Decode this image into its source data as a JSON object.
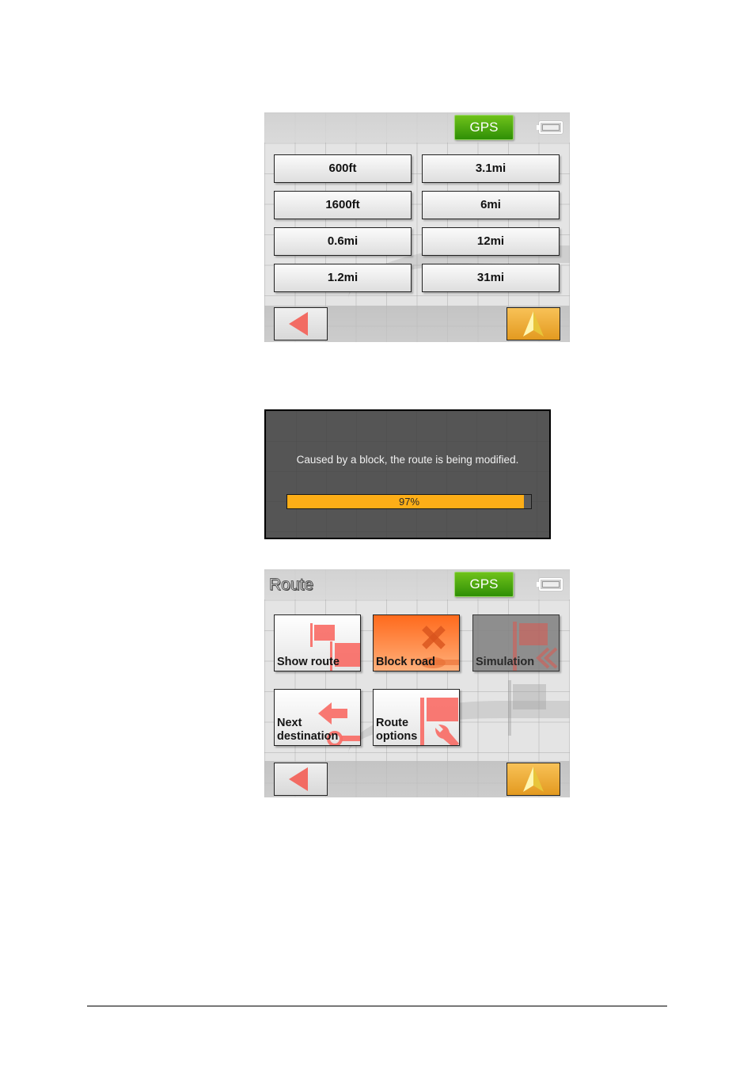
{
  "screen1": {
    "status": {
      "gps_label": "GPS",
      "battery_icon": "battery-icon"
    },
    "distance_options": [
      {
        "label": "600ft"
      },
      {
        "label": "3.1mi"
      },
      {
        "label": "1600ft"
      },
      {
        "label": "6mi"
      },
      {
        "label": "0.6mi"
      },
      {
        "label": "12mi"
      },
      {
        "label": "1.2mi"
      },
      {
        "label": "31mi"
      }
    ],
    "back_icon": "back-arrow-icon",
    "nav_icon": "navigation-arrow-icon"
  },
  "dialog": {
    "message": "Caused by a block, the route is being modified.",
    "progress_percent": 97,
    "progress_label": "97%",
    "progress_color": "#fdae17"
  },
  "screen2": {
    "title": "Route",
    "status": {
      "gps_label": "GPS",
      "battery_icon": "battery-icon"
    },
    "tiles": [
      {
        "label": "Show route",
        "icon": "flags-icon",
        "state": "normal"
      },
      {
        "label": "Block road",
        "icon": "block-x-icon",
        "state": "highlighted",
        "color": "#ff6a1c"
      },
      {
        "label": "Simulation",
        "icon": "simulation-flag-icon",
        "state": "disabled"
      },
      {
        "label_line1": "Next",
        "label_line2": "destination",
        "icon": "next-destination-arrow-icon",
        "state": "normal"
      },
      {
        "label_line1": "Route",
        "label_line2": "options",
        "icon": "route-options-wrench-icon",
        "state": "normal"
      }
    ],
    "back_icon": "back-arrow-icon",
    "nav_icon": "navigation-arrow-icon"
  }
}
